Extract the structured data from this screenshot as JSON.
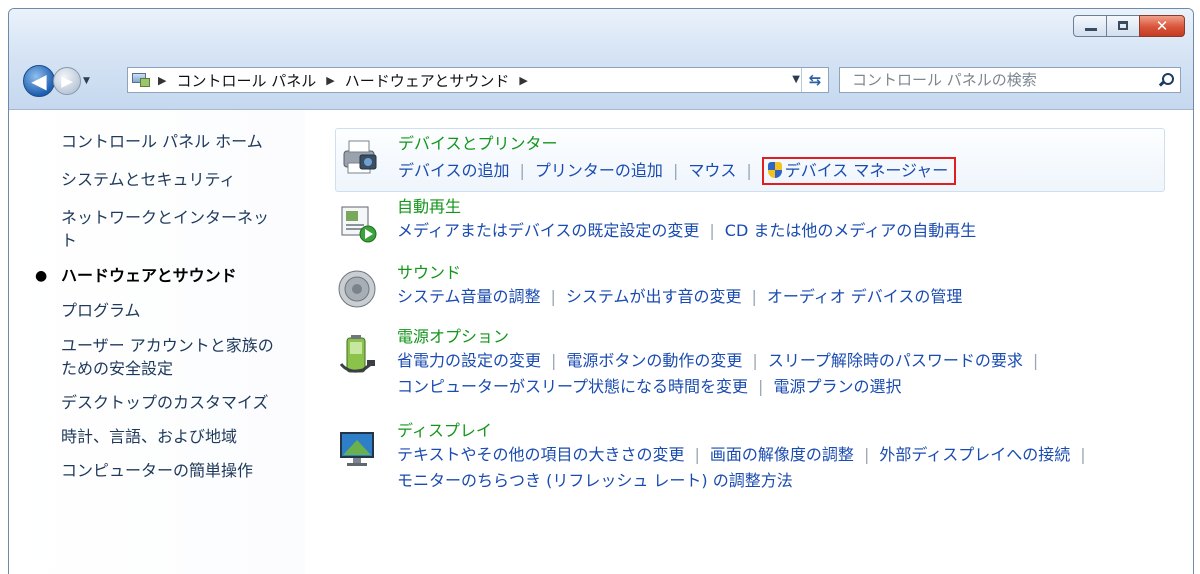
{
  "window": {
    "controls": {
      "minimize_icon": "minimize-icon",
      "maximize_icon": "maximize-icon",
      "close_icon": "close-icon"
    }
  },
  "nav": {
    "back_glyph": "◀",
    "forward_glyph": "▶",
    "dropdown_glyph": "▼"
  },
  "address": {
    "separator": "▶",
    "crumbs": [
      "コントロール パネル",
      "ハードウェアとサウンド"
    ],
    "dropdown_glyph": "▼",
    "refresh_glyph": "⇆"
  },
  "search": {
    "placeholder": "コントロール パネルの検索"
  },
  "sidebar": {
    "items": [
      {
        "label": "コントロール パネル ホーム"
      },
      {
        "label": "システムとセキュリティ"
      },
      {
        "label": "ネットワークとインターネッ"
      },
      {
        "label": "ト"
      },
      {
        "label": "ハードウェアとサウンド",
        "current": true,
        "bullet": "●"
      },
      {
        "label": "プログラム"
      },
      {
        "label": "ユーザー アカウントと家族の"
      },
      {
        "label": "ための安全設定"
      },
      {
        "label": "デスクトップのカスタマイズ"
      },
      {
        "label": "時計、言語、および地域"
      },
      {
        "label": "コンピューターの簡単操作"
      }
    ]
  },
  "categories": [
    {
      "title": "デバイスとプリンター",
      "icon": "printer-icon",
      "links": [
        "デバイスの追加",
        "プリンターの追加",
        "マウス"
      ],
      "highlighted_link": "デバイス マネージャー",
      "highlight_color": "#e02020"
    },
    {
      "title": "自動再生",
      "icon": "autoplay-icon",
      "links": [
        "メディアまたはデバイスの既定設定の変更",
        "CD または他のメディアの自動再生"
      ]
    },
    {
      "title": "サウンド",
      "icon": "speaker-icon",
      "links": [
        "システム音量の調整",
        "システムが出す音の変更",
        "オーディオ デバイスの管理"
      ]
    },
    {
      "title": "電源オプション",
      "icon": "battery-icon",
      "links": [
        "省電力の設定の変更",
        "電源ボタンの動作の変更",
        "スリープ解除時のパスワードの要求"
      ],
      "links2": [
        "コンピューターがスリープ状態になる時間を変更",
        "電源プランの選択"
      ]
    },
    {
      "title": "ディスプレイ",
      "icon": "display-icon",
      "links": [
        "テキストやその他の項目の大きさの変更",
        "画面の解像度の調整",
        "外部ディスプレイへの接続"
      ],
      "links2": [
        "モニターのちらつき (リフレッシュ レート) の調整方法"
      ]
    }
  ],
  "colors": {
    "title_green": "#13961b",
    "link_blue": "#1a4bb0",
    "nav_text": "#1e395b"
  },
  "pipe": "|"
}
